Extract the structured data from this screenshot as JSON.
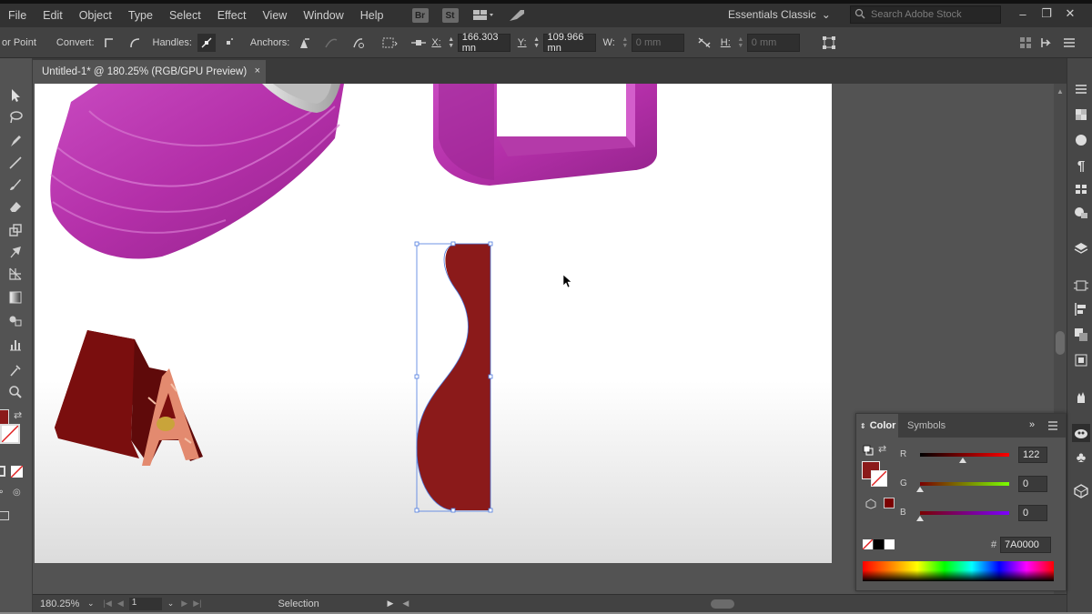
{
  "menu": {
    "items": [
      "File",
      "Edit",
      "Object",
      "Type",
      "Select",
      "Effect",
      "View",
      "Window",
      "Help"
    ],
    "bridge_label": "Br",
    "stock_label": "St",
    "workspace": "Essentials Classic",
    "search_placeholder": "Search Adobe Stock"
  },
  "control_bar": {
    "anchor_point_label": "or Point",
    "convert_label": "Convert:",
    "handles_label": "Handles:",
    "anchors_label": "Anchors:",
    "x_label": "X:",
    "x_value": "166.303 mn",
    "y_label": "Y:",
    "y_value": "109.966 mn",
    "w_label": "W:",
    "w_value": "0 mm",
    "h_label": "H:",
    "h_value": "0 mm"
  },
  "document": {
    "tab_title": "Untitled-1* @ 180.25% (RGB/GPU Preview)",
    "tab_close": "×"
  },
  "status_bar": {
    "zoom": "180.25%",
    "artboard_number": "1",
    "tool": "Selection"
  },
  "color_panel": {
    "tab_color": "Color",
    "tab_symbols": "Symbols",
    "r_label": "R",
    "g_label": "G",
    "b_label": "B",
    "r_value": "122",
    "g_value": "0",
    "b_value": "0",
    "r": 122,
    "g": 0,
    "b": 0,
    "hex_label": "#",
    "hex_value": "7A0000"
  },
  "colors": {
    "fill": "#8b1a1a",
    "magenta": "#c035b3",
    "letter_face": "#7a0e0e"
  }
}
